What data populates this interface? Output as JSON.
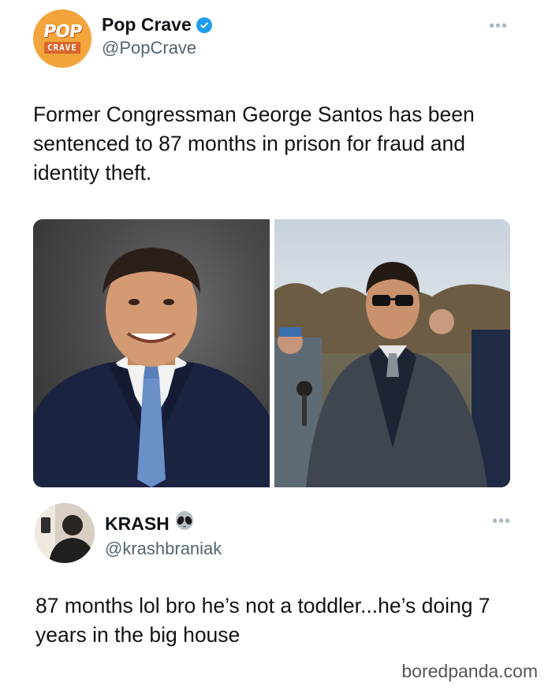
{
  "tweet1": {
    "avatar": {
      "logo_text_top": "POP",
      "logo_text_bottom": "CRAVE",
      "icon": "pop-crave-logo"
    },
    "display_name": "Pop Crave",
    "verified_icon": "verified-badge-icon",
    "handle": "@PopCrave",
    "more_icon": "more-options-icon",
    "text": "Former Congressman George Santos has been sentenced to 87 months in prison for fraud and identity theft.",
    "media": [
      {
        "description_icon": "portrait-photo"
      },
      {
        "description_icon": "outdoor-photo"
      }
    ]
  },
  "tweet2": {
    "display_name": "KRASH",
    "badge_icon": "alien-emoji-icon",
    "handle": "@krashbraniak",
    "more_icon": "more-options-icon",
    "text": "87 months lol bro he’s not a toddler...he’s doing 7 years in the big house"
  },
  "watermark": "boredpanda.com",
  "colors": {
    "text_primary": "#0f1419",
    "text_secondary": "#536471",
    "verified_blue": "#1d9bf0",
    "pop_crave_orange": "#f3a43b"
  }
}
